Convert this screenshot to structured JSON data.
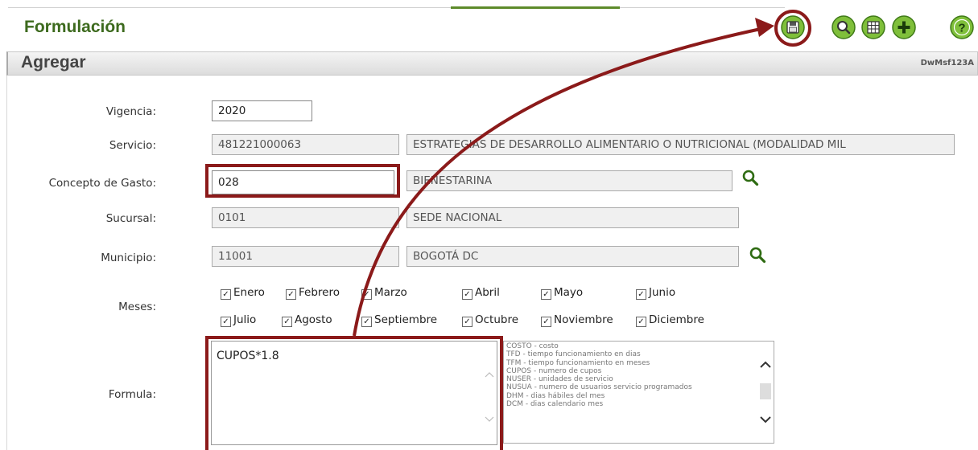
{
  "header": {
    "title": "Formulación"
  },
  "toolbar": {
    "icons": [
      "save-icon",
      "search-icon",
      "grid-icon",
      "add-icon",
      "help-icon"
    ],
    "accent": "#3d6a1e",
    "highlight_color": "#8b1a1a"
  },
  "section": {
    "title": "Agregar",
    "code": "DwMsf123A"
  },
  "form": {
    "vigencia": {
      "label": "Vigencia:",
      "value": "2020"
    },
    "servicio": {
      "label": "Servicio:",
      "code": "481221000063",
      "description": "ESTRATEGIAS DE DESARROLLO ALIMENTARIO O NUTRICIONAL (MODALIDAD MIL"
    },
    "concepto": {
      "label": "Concepto de Gasto:",
      "code": "028",
      "description": "BIENESTARINA"
    },
    "sucursal": {
      "label": "Sucursal:",
      "code": "0101",
      "description": "SEDE NACIONAL"
    },
    "municipio": {
      "label": "Municipio:",
      "code": "11001",
      "description": "BOGOTÁ DC"
    },
    "meses": {
      "label": "Meses:",
      "months": [
        {
          "name": "Enero",
          "checked": true
        },
        {
          "name": "Febrero",
          "checked": true
        },
        {
          "name": "Marzo",
          "checked": true
        },
        {
          "name": "Abril",
          "checked": true
        },
        {
          "name": "Mayo",
          "checked": true
        },
        {
          "name": "Junio",
          "checked": true
        },
        {
          "name": "Julio",
          "checked": true
        },
        {
          "name": "Agosto",
          "checked": true
        },
        {
          "name": "Septiembre",
          "checked": true
        },
        {
          "name": "Octubre",
          "checked": true
        },
        {
          "name": "Noviembre",
          "checked": true
        },
        {
          "name": "Diciembre",
          "checked": true
        }
      ]
    },
    "formula": {
      "label": "Formula:",
      "value": "CUPOS*1.8",
      "variables": [
        "COSTO - costo",
        "TFD - tiempo funcionamiento en dias",
        "TFM - tiempo funcionamiento en meses",
        "CUPOS - numero de cupos",
        "NUSER - unidades de servicio",
        "NUSUA - numero de usuarios servicio programados",
        "DHM - dias hábiles del mes",
        "DCM - dias calendario mes"
      ]
    }
  }
}
